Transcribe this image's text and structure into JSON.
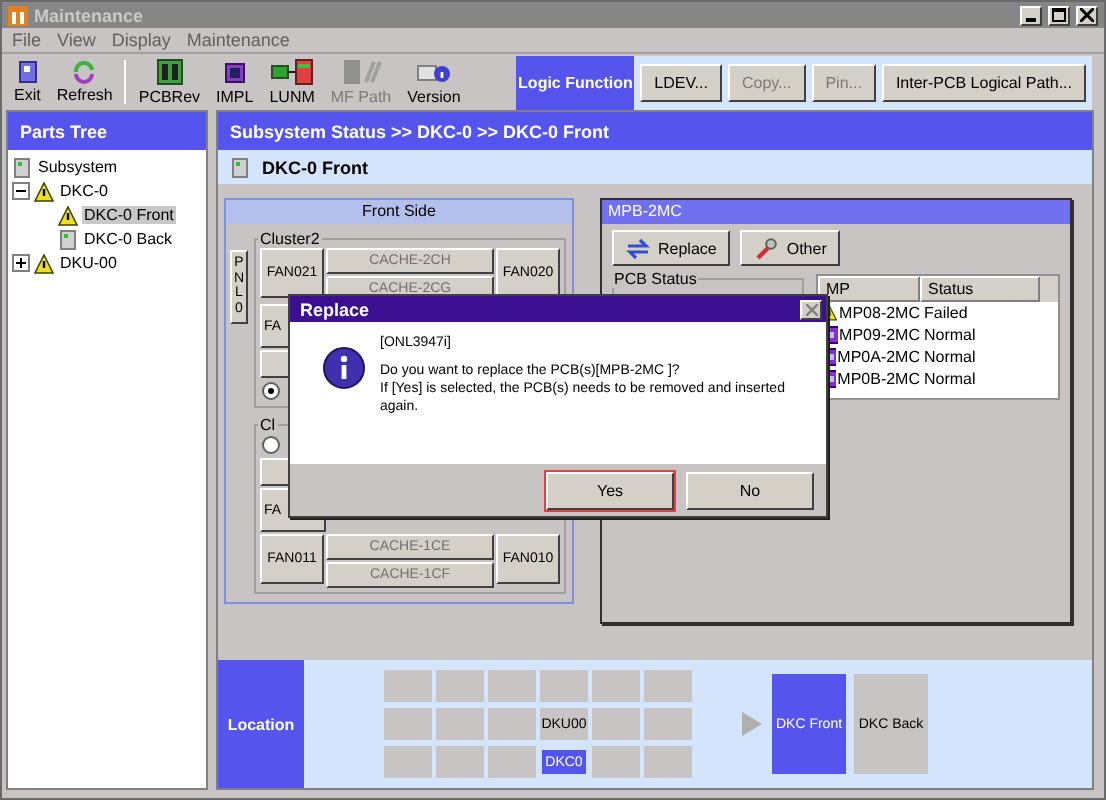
{
  "window": {
    "title": "Maintenance"
  },
  "menu": [
    {
      "label": "File",
      "disabled": false
    },
    {
      "label": "View",
      "disabled": false
    },
    {
      "label": "Display",
      "disabled": false
    },
    {
      "label": "Maintenance",
      "disabled": false
    }
  ],
  "toolbar": [
    {
      "kind": "exit",
      "label": "Exit",
      "disabled": false
    },
    {
      "kind": "refresh",
      "label": "Refresh",
      "disabled": false
    },
    {
      "kind": "pcb",
      "label": "PCBRev",
      "disabled": false
    },
    {
      "kind": "chip",
      "label": "IMPL",
      "disabled": false
    },
    {
      "kind": "network",
      "label": "LUNM",
      "disabled": false
    },
    {
      "kind": "path",
      "label": "MF Path",
      "disabled": true
    },
    {
      "kind": "info",
      "label": "Version",
      "disabled": false
    }
  ],
  "logic_function": {
    "label": "Logic Function",
    "buttons": [
      {
        "label": "LDEV...",
        "disabled": false
      },
      {
        "label": "Copy...",
        "disabled": true
      },
      {
        "label": "Pin...",
        "disabled": true
      },
      {
        "label": "Inter-PCB Logical Path...",
        "disabled": false
      }
    ]
  },
  "parts_tree": {
    "title": "Parts Tree",
    "items": [
      {
        "label": "Subsystem",
        "alert": false,
        "selected": false
      },
      {
        "label": "DKC-0",
        "alert": true,
        "selected": false,
        "expanded": true,
        "children": [
          {
            "label": "DKC-0 Front",
            "alert": true,
            "selected": true
          },
          {
            "label": "DKC-0 Back",
            "alert": false,
            "selected": false
          }
        ]
      },
      {
        "label": "DKU-00",
        "alert": true,
        "selected": false,
        "expanded": false
      }
    ]
  },
  "breadcrumb": "Subsystem Status >> DKC-0 >> DKC-0 Front",
  "page_title": "DKC-0 Front",
  "front_side": {
    "title": "Front Side",
    "panel_button": "PNL0",
    "clusters": [
      {
        "label": "Cluster2",
        "units": [
          {
            "kind": "fan_row",
            "left": "FAN021",
            "caches": [
              {
                "label": "CACHE-2CH",
                "disabled": true
              },
              {
                "label": "CACHE-2CG",
                "disabled": true
              }
            ],
            "right": "FAN020"
          },
          {
            "kind": "button",
            "label": "FA"
          },
          {
            "kind": "button"
          },
          {
            "kind": "radio",
            "selected": true
          }
        ]
      },
      {
        "label": "Cl",
        "units": [
          {
            "kind": "radio",
            "selected": false
          },
          {
            "kind": "button"
          },
          {
            "kind": "button",
            "label": "FA"
          },
          {
            "kind": "fan_row",
            "left": "FAN011",
            "caches": [
              {
                "label": "CACHE-1CE",
                "disabled": true
              },
              {
                "label": "CACHE-1CF",
                "disabled": true
              }
            ],
            "right": "FAN010"
          }
        ]
      }
    ]
  },
  "mpb_panel": {
    "title": "MPB-2MC",
    "buttons": [
      {
        "kind": "replace",
        "label": "Replace"
      },
      {
        "kind": "other",
        "label": "Other"
      }
    ],
    "group_title": "PCB Status",
    "table": {
      "columns": [
        "MP",
        "Status"
      ],
      "rows": [
        {
          "mp": "MP08-2MC",
          "status": "Failed",
          "alert": true
        },
        {
          "mp": "MP09-2MC",
          "status": "Normal",
          "alert": false
        },
        {
          "mp": "MP0A-2MC",
          "status": "Normal",
          "alert": false
        },
        {
          "mp": "MP0B-2MC",
          "status": "Normal",
          "alert": false
        }
      ]
    }
  },
  "location": {
    "title": "Location",
    "cells": [
      {
        "selected": false
      },
      {
        "selected": false
      },
      {
        "selected": false
      },
      {
        "selected": false
      },
      {
        "selected": false
      },
      {
        "selected": false
      },
      {
        "selected": false
      },
      {
        "selected": false
      },
      {
        "selected": false
      },
      {
        "label": "DKU00",
        "selected": false
      },
      {
        "selected": false
      },
      {
        "selected": false
      },
      {
        "selected": false
      },
      {
        "selected": false
      },
      {
        "selected": false
      },
      {
        "label": "DKC0",
        "selected": true
      },
      {
        "selected": false
      },
      {
        "selected": false
      }
    ],
    "views": [
      {
        "label": "DKC Front",
        "selected": true
      },
      {
        "label": "DKC Back",
        "selected": false
      }
    ]
  },
  "dialog": {
    "title": "Replace",
    "code": "[ONL3947i]",
    "lines": [
      "Do you want to replace the PCB(s)[MPB-2MC ]?",
      "If [Yes] is selected, the PCB(s) needs to be removed and inserted again."
    ],
    "buttons": [
      {
        "label": "Yes",
        "focused": true
      },
      {
        "label": "No",
        "focused": false
      }
    ]
  }
}
